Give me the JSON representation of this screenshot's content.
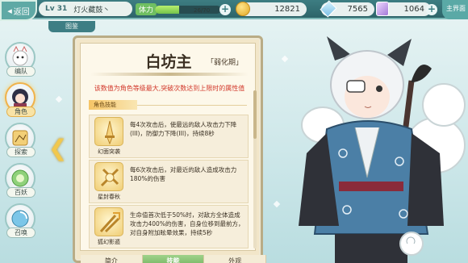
{
  "topbar": {
    "back_label": "返回",
    "level": "Lv 31",
    "player_name": "灯火藏鼓丶",
    "stamina_label": "体力",
    "stamina_value": "26/70",
    "stamina_fraction": 0.37,
    "gold": "12821",
    "gems": "7565",
    "crystals": "1064",
    "main_label": "主界面"
  },
  "section_tab": "图鉴",
  "sidenav": [
    {
      "label": "编队",
      "icon": "cat-spirit-icon",
      "active": false
    },
    {
      "label": "角色",
      "icon": "character-portrait-icon",
      "active": true
    },
    {
      "label": "探索",
      "icon": "explore-map-icon",
      "active": false
    },
    {
      "label": "百妖",
      "icon": "spirit-orb-icon",
      "active": false
    },
    {
      "label": "召唤",
      "icon": "summon-portal-icon",
      "active": false
    }
  ],
  "card": {
    "title": "白坊主",
    "phase": "「弱化期」",
    "note": "该数值为角色等级最大,突破次数达到上限时的属性值",
    "section_header": "角色技能",
    "skills": [
      {
        "name": "幻面突袭",
        "desc": "每4次攻击后，使最远的敌人攻击力下降(III)，防御力下降(III)，持续8秒"
      },
      {
        "name": "星封春秋",
        "desc": "每6次攻击后，对最近的敌人造成攻击力180%的伤害"
      },
      {
        "name": "狐幻影遁",
        "desc": "生命值首次低于50%时，对敌方全体造成攻击力400%的伤害，自身位移到最前方，对自身附加眩晕效果，持续5秒"
      }
    ],
    "tabs": [
      {
        "label": "简介",
        "active": false
      },
      {
        "label": "技能",
        "active": true
      },
      {
        "label": "外观",
        "active": false
      }
    ]
  },
  "colors": {
    "accent": "#3e7e84",
    "warning_text": "#d2382b",
    "active_tab": "#6fb15d"
  }
}
